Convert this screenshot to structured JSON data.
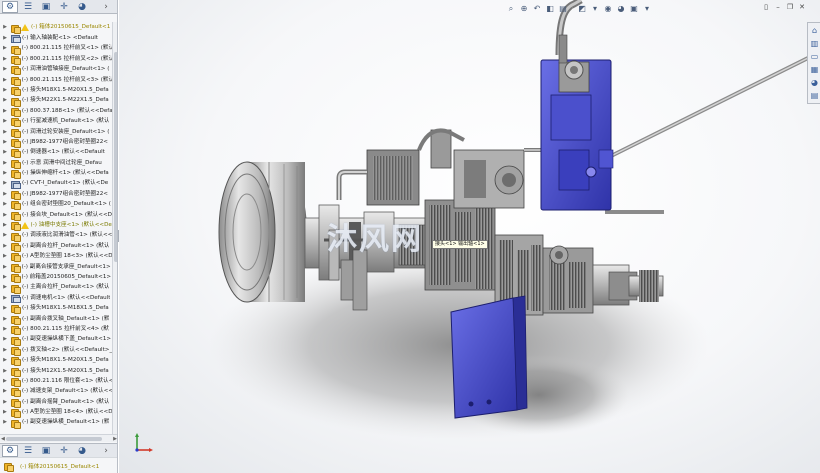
{
  "panel": {
    "tabs": [
      "feature-manager",
      "property-manager",
      "configuration-manager",
      "dimxpert-manager",
      "display-manager"
    ],
    "root_label": "(-) 箱体20150615_Default<1",
    "items": [
      {
        "label": "(-) 输入轴装配<1> <Default",
        "type": "asm"
      },
      {
        "label": "(-) 800.21.115 拉杆前叉<1> (默认",
        "type": "part"
      },
      {
        "label": "(-) 800.21.115 拉杆前叉<2> (默认",
        "type": "part"
      },
      {
        "label": "(-) 润滑油管轴接座_Default<1> (",
        "type": "part"
      },
      {
        "label": "(-) 800.21.115 拉杆前叉<3> (默认",
        "type": "part"
      },
      {
        "label": "(-) 接头M18X1.5-M20X1.5_Defa",
        "type": "part"
      },
      {
        "label": "(-) 接头M22X1.5-M22X1.5_Defa",
        "type": "part"
      },
      {
        "label": "(-) 800.37.188<1> (默认<<Defa",
        "type": "part"
      },
      {
        "label": "(-) 行星减速机_Default<1> (默认",
        "type": "part"
      },
      {
        "label": "(-) 润滑过轮安装座_Default<1> (",
        "type": "part"
      },
      {
        "label": "(-) JB982-1977组合密封垫圈22<",
        "type": "part"
      },
      {
        "label": "(-) 倒速器<1> (默认<<Default",
        "type": "part"
      },
      {
        "label": "(-) 示意 润滑中间过轮座_Defau",
        "type": "part"
      },
      {
        "label": "(-) 操纵伸缩杆<1> (默认<<Defa",
        "type": "part"
      },
      {
        "label": "(-) CVT-Ⅰ_Default<1> (默认<De",
        "type": "asm"
      },
      {
        "label": "(-) JB982-1977组合密封垫圈22<",
        "type": "part"
      },
      {
        "label": "(-) 组合密封垫圈20_Default<1> (",
        "type": "part"
      },
      {
        "label": "(-) 接合块_Default<1> (默认<<D",
        "type": "part"
      },
      {
        "label": "(-) 油槽中支座<1> (默认<<Def",
        "type": "part",
        "warn": true
      },
      {
        "label": "(-) 调液液比润滑油管<1> (默认<<",
        "type": "part"
      },
      {
        "label": "(-) 副离合拉杆_Default<1> (默认",
        "type": "part"
      },
      {
        "label": "(-) A型防尘垫圈 18<3> (默认<<D",
        "type": "part"
      },
      {
        "label": "(-) 副离合接管支承座_Default<1> (",
        "type": "part"
      },
      {
        "label": "(-) 前箱盖20150605_Default<1> (",
        "type": "part"
      },
      {
        "label": "(-) 主离合拉杆_Default<1> (默认",
        "type": "part"
      },
      {
        "label": "(-) 调速电机<1> (默认<<Default",
        "type": "asm"
      },
      {
        "label": "(-) 接头M18X1.5-M18X1.5_Defa",
        "type": "part"
      },
      {
        "label": "(-) 副离合拨叉轴_Default<1> (默",
        "type": "part"
      },
      {
        "label": "(-) 800.21.115 拉杆前叉<4> (默",
        "type": "part"
      },
      {
        "label": "(-) 副变速操纵横下盖_Default<1>",
        "type": "part"
      },
      {
        "label": "(-) 拨叉轴<2> (默认<<Default>_",
        "type": "part"
      },
      {
        "label": "(-) 接头M18X1.5-M20X1.5_Defa",
        "type": "part"
      },
      {
        "label": "(-) 接头M12X1.5-M20X1.5_Defa",
        "type": "part"
      },
      {
        "label": "(-) 800.21.116 限位套<1> (默认<",
        "type": "part"
      },
      {
        "label": "(-) 减速支架_Default<1> (默认<<",
        "type": "part"
      },
      {
        "label": "(-) 副离合摇臂_Default<1> (默认",
        "type": "part"
      },
      {
        "label": "(-) A型防尘垫圈 18<4> (默认<<D",
        "type": "part"
      },
      {
        "label": "(-) 副变速操纵横_Default<1> (默",
        "type": "part"
      }
    ],
    "bottom_label": "(-) 箱体20150615_Default<1"
  },
  "viewport": {
    "watermark": "沐风网",
    "tooltip": "接头<1> 输出轴<1>",
    "heads_up_icons": [
      "zoom-to-fit-icon",
      "zoom-area-icon",
      "previous-view-icon",
      "section-view-icon",
      "dynamic-annotation-icon",
      "view-orientation-icon",
      "display-style-icon",
      "hide-show-icon",
      "edit-appearance-icon",
      "apply-scene-icon",
      "view-settings-icon"
    ],
    "task_pane_icons": [
      "home-icon",
      "design-library-icon",
      "file-explorer-icon",
      "view-palette-icon",
      "appearances-icon",
      "custom-properties-icon"
    ]
  },
  "colors": {
    "accent_part": "#4a4fc8",
    "body_metal": "#bdbdbd",
    "dark_metal": "#6e6e6e"
  }
}
